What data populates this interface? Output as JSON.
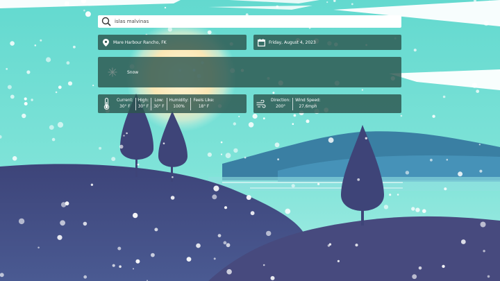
{
  "search": {
    "value": "islas malvinas"
  },
  "location": {
    "text": "Mare Harbour Rancho, FK"
  },
  "date": {
    "text": "Friday, August 4, 2023"
  },
  "condition": {
    "text": "Snow"
  },
  "temps": {
    "current_label": "Current:",
    "current_value": "30° F",
    "high_label": "High:",
    "high_value": "30° F",
    "low_label": "Low:",
    "low_value": "30° F",
    "humidity_label": "Humidity:",
    "humidity_value": "100%",
    "feels_label": "Feels Like:",
    "feels_value": "18° F"
  },
  "wind": {
    "direction_label": "Direction:",
    "direction_value": "200°",
    "speed_label": "Wind Speed:",
    "speed_value": "27.6mph"
  },
  "icons": [
    "search-icon",
    "map-pin-icon",
    "calendar-icon",
    "snowflake-icon",
    "thermometer-icon",
    "wind-icon"
  ],
  "colors": {
    "panel": "#2c564e",
    "sky": "#3cc7c8",
    "hills": "#3f4679",
    "mountain": "#3a7fa3"
  }
}
